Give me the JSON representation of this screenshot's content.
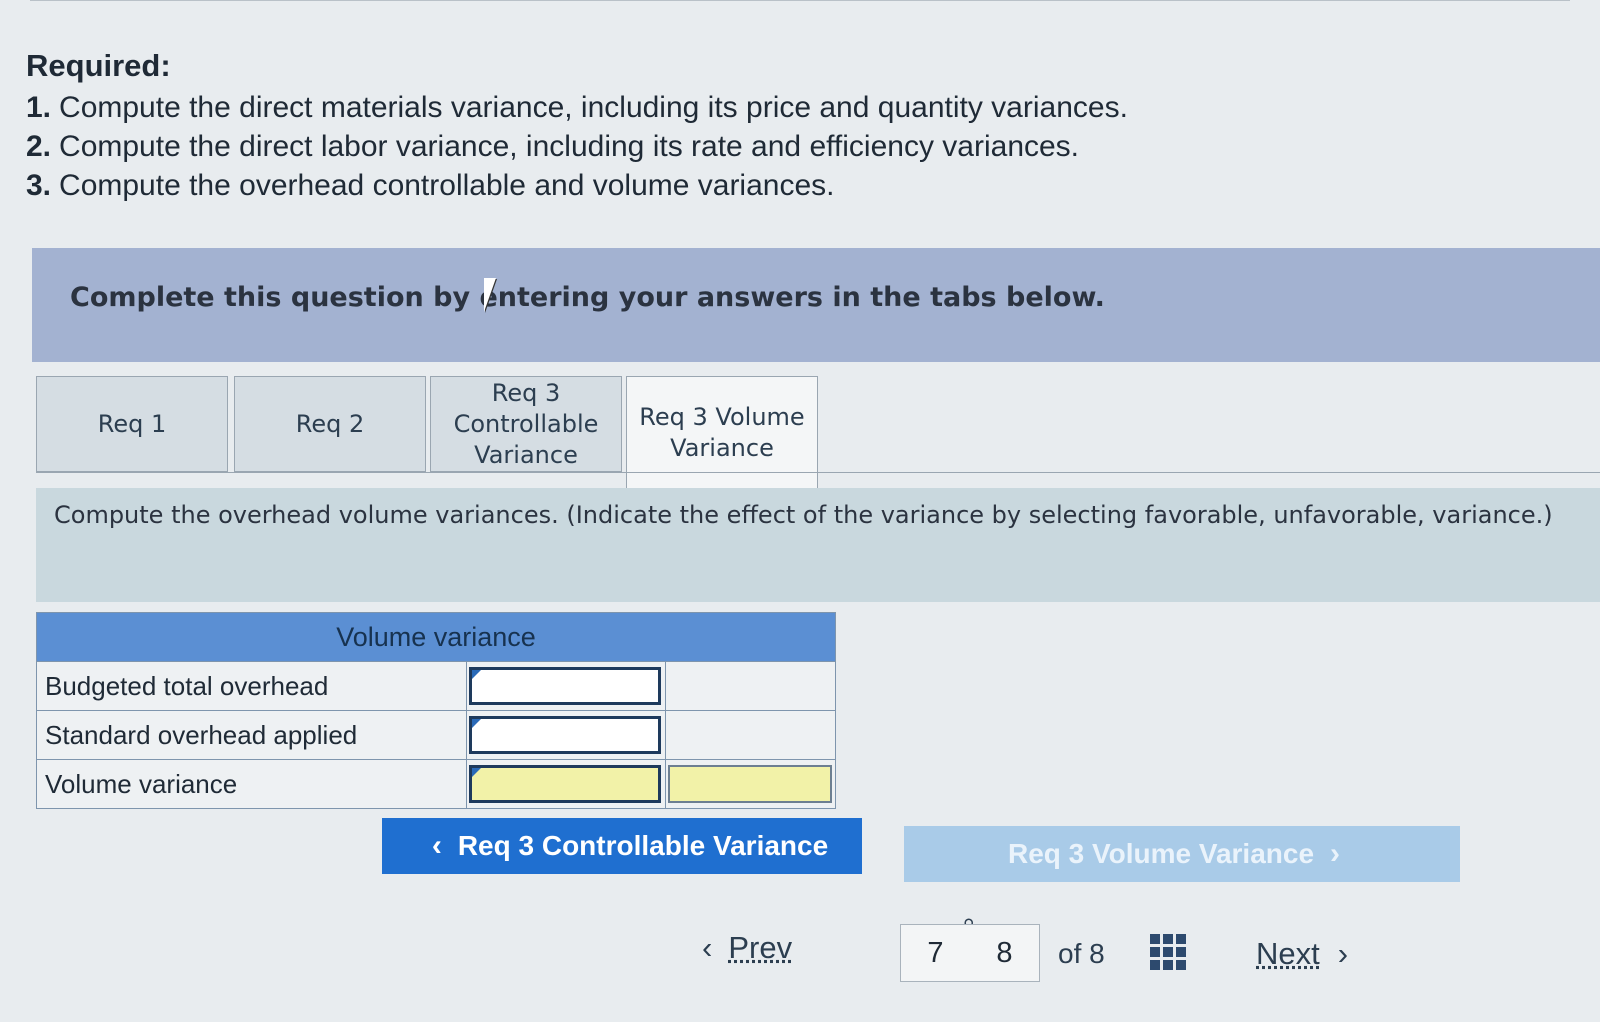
{
  "required": {
    "title": "Required:",
    "items": [
      {
        "num": "1.",
        "text": "Compute the direct materials variance, including its price and quantity variances."
      },
      {
        "num": "2.",
        "text": "Compute the direct labor variance, including its rate and efficiency variances."
      },
      {
        "num": "3.",
        "text": "Compute the overhead controllable and volume variances."
      }
    ]
  },
  "instruction": "Complete this question by entering your answers in the tabs below.",
  "tabs": [
    {
      "label": "Req 1",
      "active": false
    },
    {
      "label": "Req 2",
      "active": false
    },
    {
      "label": "Req 3 Controllable Variance",
      "active": false
    },
    {
      "label": "Req 3 Volume Variance",
      "active": true
    }
  ],
  "prompt": "Compute the overhead volume variances. (Indicate the effect of the variance by selecting favorable, unfavorable, variance.)",
  "table": {
    "header": "Volume variance",
    "rows": [
      {
        "label": "Budgeted total overhead",
        "value": "",
        "effect": ""
      },
      {
        "label": "Standard overhead applied",
        "value": "",
        "effect": ""
      },
      {
        "label": "Volume variance",
        "value": "",
        "effect": ""
      }
    ]
  },
  "nav_buttons": {
    "prev_req": "Req 3 Controllable Variance",
    "next_req": "Req 3 Volume Variance"
  },
  "pagination": {
    "prev": "Prev",
    "pages": [
      "7",
      "8"
    ],
    "of": "of 8",
    "next": "Next"
  },
  "icons": {
    "left_chevron": "‹",
    "right_chevron": "›",
    "link": "link-icon",
    "grid": "grid-icon"
  },
  "colors": {
    "instruction_band": "#a3b2d1",
    "table_header": "#5b8fd3",
    "primary_button": "#1f6fd0",
    "disabled_button": "#a9cbe8",
    "total_cell": "#f2f2a8"
  }
}
